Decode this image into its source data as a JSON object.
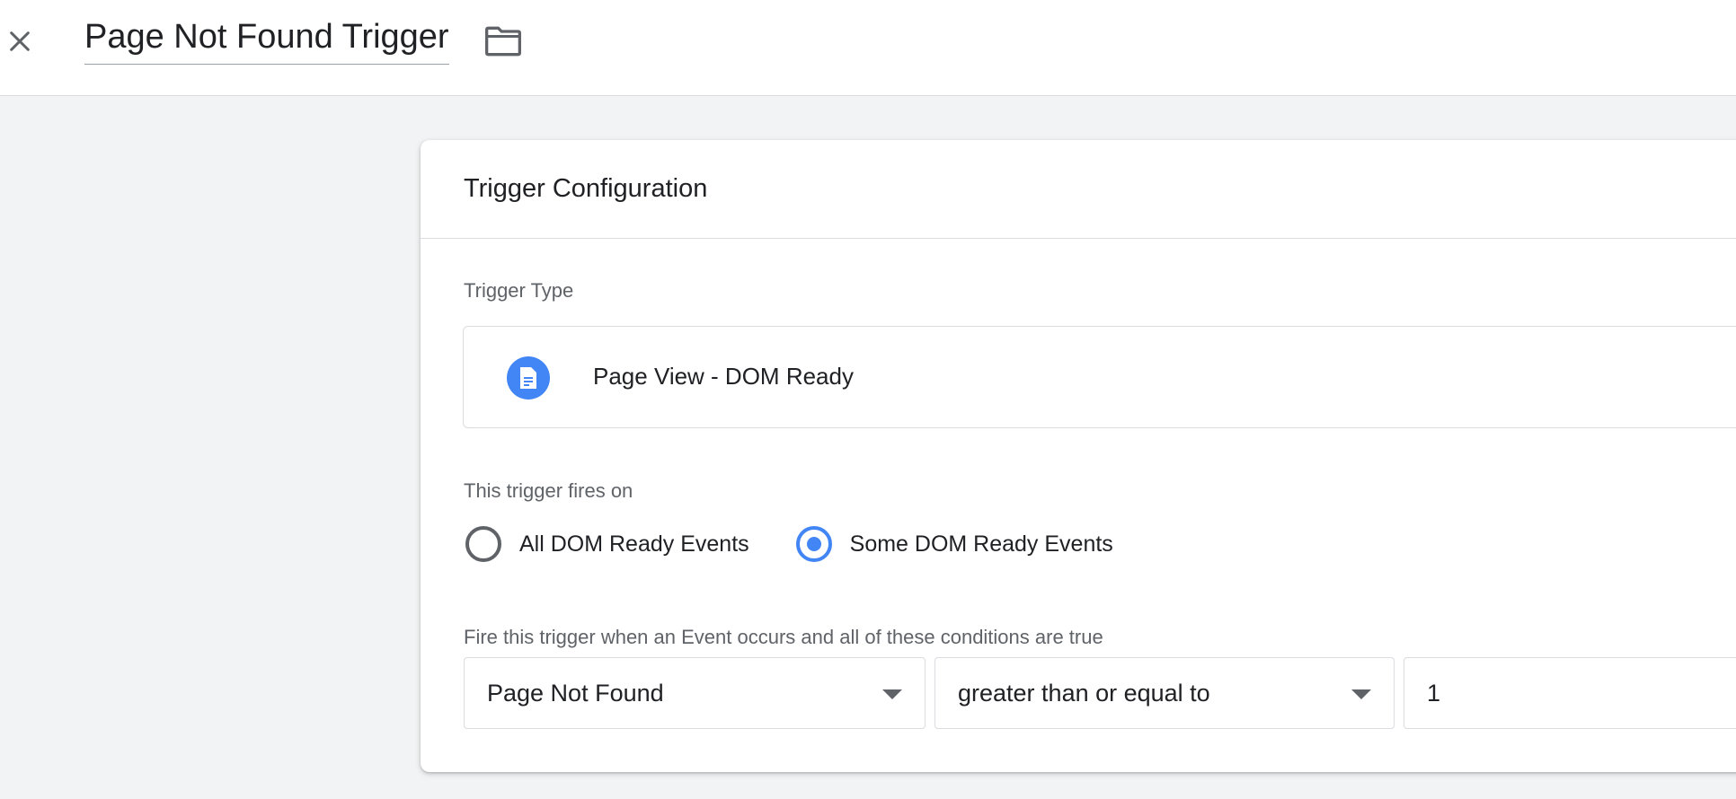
{
  "header": {
    "title": "Page Not Found Trigger",
    "close_icon": "close-icon",
    "folder_icon": "folder-icon"
  },
  "card": {
    "title": "Trigger Configuration",
    "trigger_type_label": "Trigger Type",
    "trigger_type": {
      "icon": "document-icon",
      "label": "Page View - DOM Ready",
      "icon_color": "#4285f4"
    },
    "fires_on_label": "This trigger fires on",
    "fires_on_options": [
      {
        "label": "All DOM Ready Events",
        "selected": false
      },
      {
        "label": "Some DOM Ready Events",
        "selected": true
      }
    ],
    "conditions_label": "Fire this trigger when an Event occurs and all of these conditions are true",
    "condition": {
      "variable": "Page Not Found",
      "operator": "greater than or equal to",
      "value": "1"
    }
  },
  "colors": {
    "accent": "#4285f4",
    "background": "#f1f3f4",
    "text": "#202124",
    "secondary_text": "#5f6368"
  }
}
